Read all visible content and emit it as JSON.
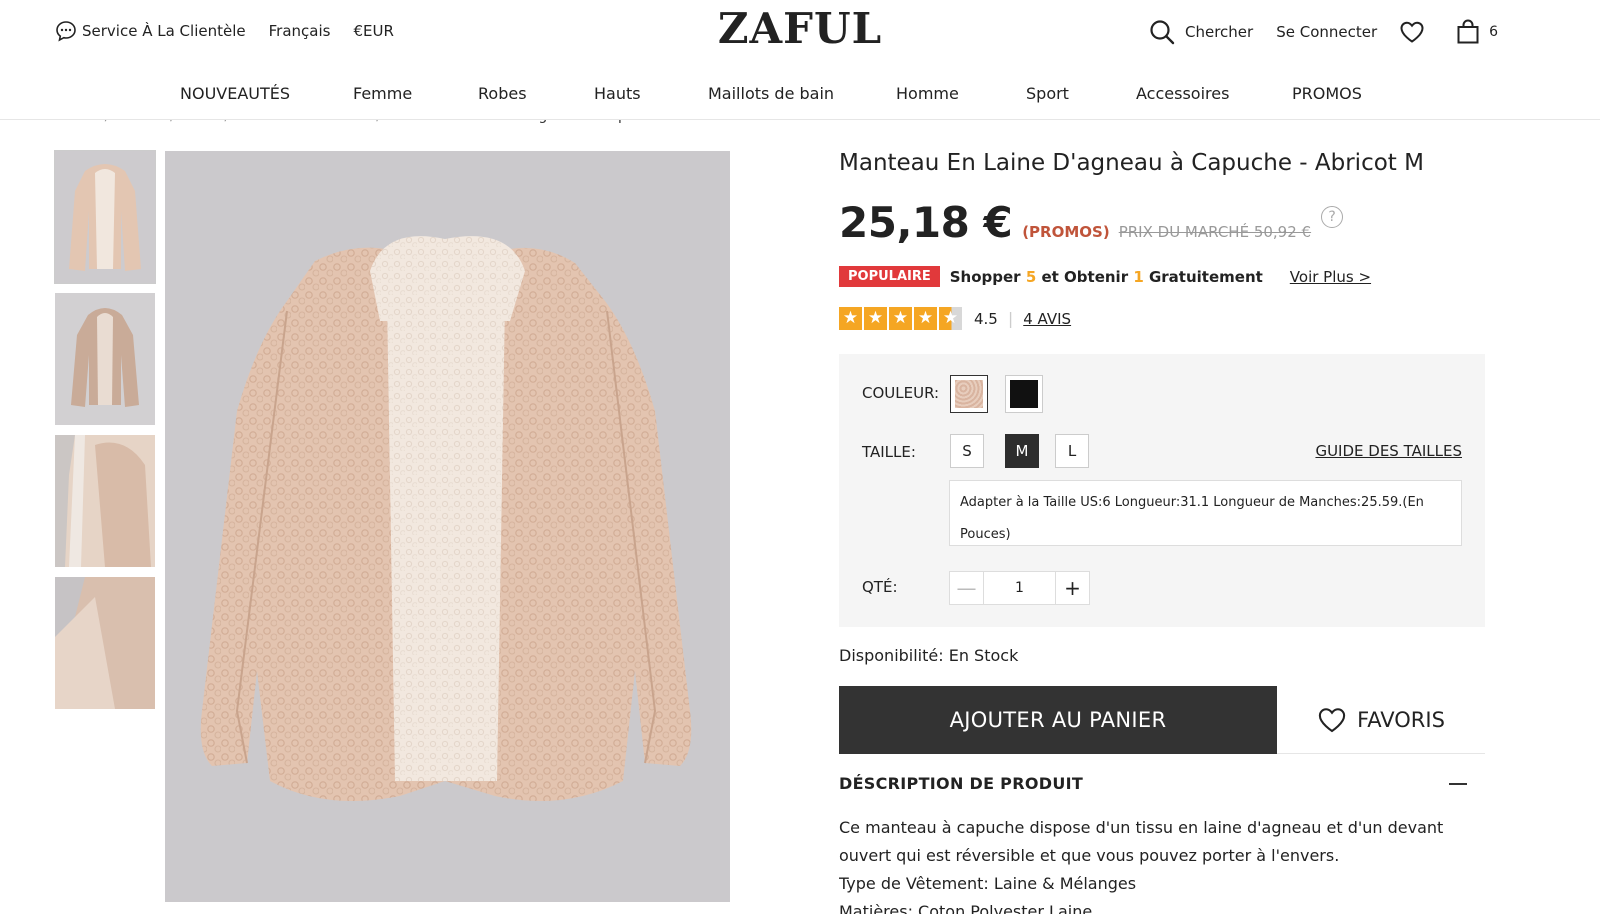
{
  "topbar": {
    "service": "Service À La Clientèle",
    "language": "Français",
    "currency": "€EUR",
    "logo": "ZAFUL",
    "search": "Chercher",
    "login": "Se Connecter",
    "cart_count": "6"
  },
  "nav": {
    "items": [
      "NOUVEAUTÉS",
      "Femme",
      "Robes",
      "Hauts",
      "Maillots de bain",
      "Homme",
      "Sport",
      "Accessoires",
      "PROMOS"
    ]
  },
  "breadcrumb": {
    "trail": "ZAFUL / Femme / Hauts / Vestes et Manteaux / ",
    "current": "Manteau en Laine D'agneau à Capuche"
  },
  "product": {
    "title": "Manteau En Laine D'agneau à Capuche - Abricot M",
    "price": "25,18 €",
    "promo_tag": "(PROMOS)",
    "market_price": "PRIX DU MARCHÉ 50,92 €",
    "help": "?",
    "badge": "POPULAIRE",
    "offer": {
      "part1": "Shopper ",
      "n1": "5",
      "part2": " et Obtenir ",
      "n2": "1",
      "part3": " Gratuitement"
    },
    "see_more": "Voir Plus >",
    "rating": "4.5",
    "rating_value": 4.5,
    "reviews": "4 AVIS",
    "color_label": "COULEUR:",
    "colors": [
      "#e2c3b0",
      "#111111"
    ],
    "size_label": "TAILLE:",
    "sizes": [
      "S",
      "M",
      "L"
    ],
    "selected_size": "M",
    "size_guide": "GUIDE DES TAILLES",
    "size_info": "Adapter à la Taille US:6   Longueur:31.1   Longueur de Manches:25.59.(En Pouces)",
    "qty_label": "QTÉ:",
    "qty": "1",
    "availability": "Disponibilité: En Stock",
    "add_to_cart": "AJOUTER AU PANIER",
    "favorites": "FAVORIS",
    "desc_title": "DÉSCRIPTION DE PRODUIT",
    "desc_lines": [
      "Ce manteau à capuche dispose d'un tissu en laine d'agneau et d'un devant ouvert qui est réversible et que vous pouvez porter à l'envers.",
      "Type de Vêtement: Laine & Mélanges",
      "Matières: Coton,Polyester,Laine"
    ]
  },
  "colors": {
    "accent_dark": "#333333",
    "badge_red": "#e1393b",
    "promo_orange": "#c0543a",
    "star": "#f5a623",
    "coat": "#e2c3b0"
  }
}
